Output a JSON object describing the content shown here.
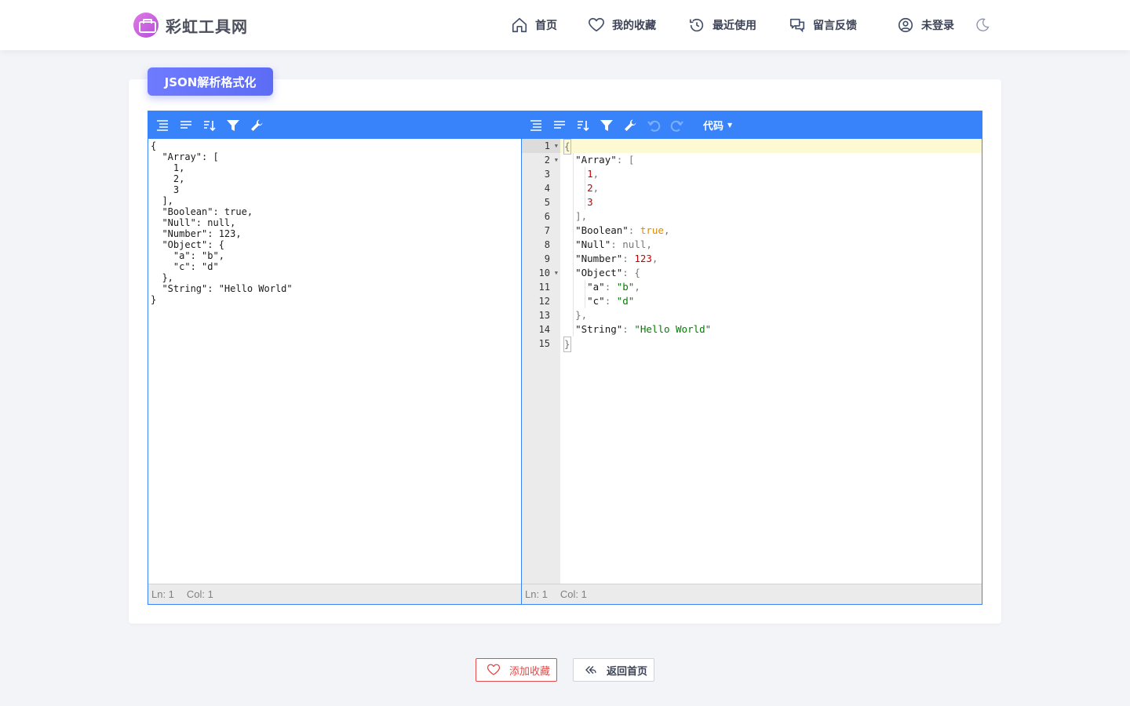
{
  "site": {
    "name": "彩虹工具网"
  },
  "nav": [
    {
      "label": "首页",
      "icon": "home-icon"
    },
    {
      "label": "我的收藏",
      "icon": "heart-icon"
    },
    {
      "label": "最近使用",
      "icon": "history-icon"
    },
    {
      "label": "留言反馈",
      "icon": "chat-icon"
    },
    {
      "label": "未登录",
      "icon": "user-icon"
    }
  ],
  "theme_toggle_icon": "moon-icon",
  "page": {
    "title": "JSON解析格式化"
  },
  "text_editor": {
    "lines": [
      "{",
      "  \"Array\": [",
      "    1,",
      "    2,",
      "    3",
      "  ],",
      "  \"Boolean\": true,",
      "  \"Null\": null,",
      "  \"Number\": 123,",
      "  \"Object\": {",
      "    \"a\": \"b\",",
      "    \"c\": \"d\"",
      "  },",
      "  \"String\": \"Hello World\"",
      "}"
    ],
    "status": {
      "ln": "Ln: 1",
      "col": "Col: 1"
    }
  },
  "code_editor": {
    "mode_label": "代码",
    "line_numbers": [
      "1",
      "2",
      "3",
      "4",
      "5",
      "6",
      "7",
      "8",
      "9",
      "10",
      "11",
      "12",
      "13",
      "14",
      "15"
    ],
    "fold_lines": [
      1,
      2,
      10
    ],
    "status": {
      "ln": "Ln: 1",
      "col": "Col: 1"
    }
  },
  "colors": {
    "accent": "#3883fa",
    "tag_gradient_start": "#6f7bff",
    "tag_gradient_end": "#5d6cf5",
    "danger": "#e64a4a",
    "json_number": "#d10000",
    "json_string": "#008000",
    "json_boolean": "#e08a00"
  },
  "buttons": {
    "favorite": {
      "label": "添加收藏",
      "icon": "heart-icon"
    },
    "home": {
      "label": "返回首页",
      "icon": "reply-icon"
    }
  }
}
